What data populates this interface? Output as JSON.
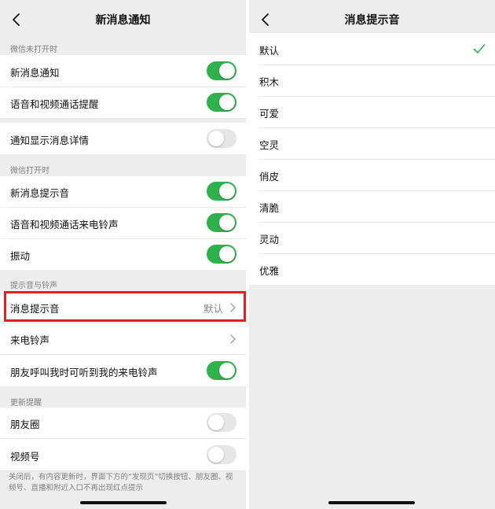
{
  "left": {
    "title": "新消息通知",
    "sections": [
      {
        "label": "微信未打开时"
      },
      {
        "label": "微信打开时"
      },
      {
        "label": "提示音与铃声"
      },
      {
        "label": "更新提醒"
      }
    ],
    "rows": {
      "new_msg_notify": {
        "label": "新消息通知",
        "toggle": "on"
      },
      "voice_video_reminder": {
        "label": "语音和视频通话提醒",
        "toggle": "on"
      },
      "show_details": {
        "label": "通知显示消息详情",
        "toggle": "off"
      },
      "new_msg_sound": {
        "label": "新消息提示音",
        "toggle": "on"
      },
      "voice_video_ringtone": {
        "label": "语音和视频通话来电铃声",
        "toggle": "on"
      },
      "vibrate": {
        "label": "振动",
        "toggle": "on"
      },
      "msg_tone": {
        "label": "消息提示音",
        "value": "默认"
      },
      "ringtone": {
        "label": "来电铃声"
      },
      "friend_hear_ringtone": {
        "label": "朋友呼叫我时可听到我的来电铃声",
        "toggle": "on"
      },
      "moments": {
        "label": "朋友圈",
        "toggle": "off"
      },
      "channels": {
        "label": "视频号",
        "toggle": "off"
      }
    },
    "footer_note": "关闭后，有内容更新时，界面下方的“发现页”切换按钮、朋友圈、视频号、直播和附近入口不再出现红点提示"
  },
  "right": {
    "title": "消息提示音",
    "sounds": [
      "默认",
      "积木",
      "可爱",
      "空灵",
      "俏皮",
      "清脆",
      "灵动",
      "优雅"
    ],
    "selected": "默认"
  },
  "colors": {
    "toggle_on": "#2fb14d",
    "toggle_off": "#e6e6e6",
    "highlight_border": "#e01f26",
    "background": "#ededed"
  },
  "icons": [
    "back-icon",
    "chevron-right-icon",
    "check-icon"
  ]
}
